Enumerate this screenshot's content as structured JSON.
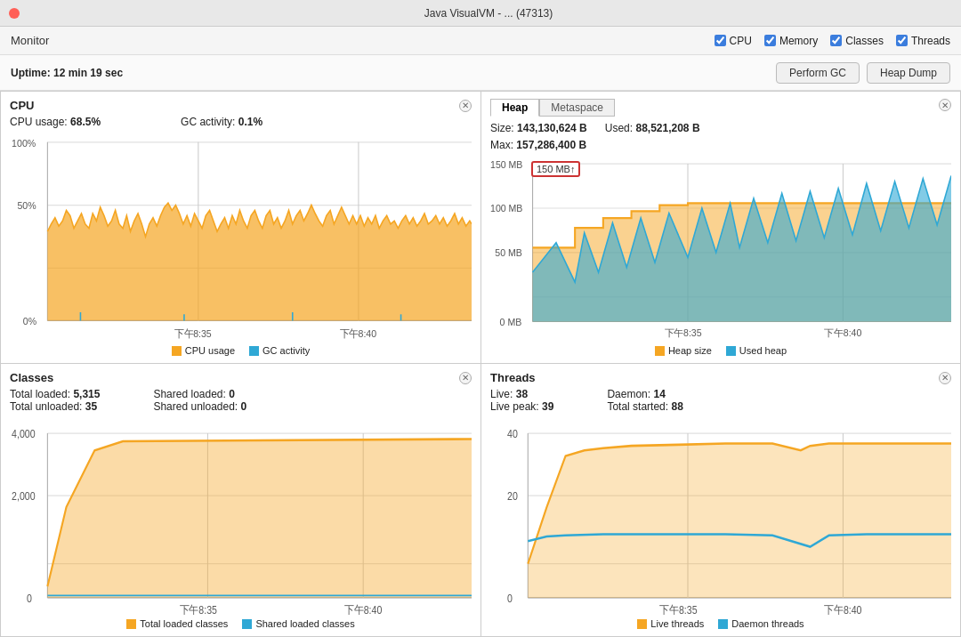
{
  "titlebar": {
    "title": "Java VisualVM - ... (47313)"
  },
  "toolbar": {
    "label": "Monitor",
    "checkboxes": [
      {
        "id": "cpu",
        "label": "CPU",
        "checked": true
      },
      {
        "id": "memory",
        "label": "Memory",
        "checked": true
      },
      {
        "id": "classes",
        "label": "Classes",
        "checked": true
      },
      {
        "id": "threads",
        "label": "Threads",
        "checked": true
      }
    ]
  },
  "statusbar": {
    "uptime_label": "Uptime:",
    "uptime_value": "12 min 19 sec",
    "btn_gc": "Perform GC",
    "btn_heap": "Heap Dump"
  },
  "cpu_panel": {
    "title": "CPU",
    "cpu_usage_label": "CPU usage:",
    "cpu_usage_value": "68.5%",
    "gc_activity_label": "GC activity:",
    "gc_activity_value": "0.1%",
    "legend_cpu": "CPU usage",
    "legend_gc": "GC activity",
    "y_labels": [
      "100%",
      "50%",
      "0%"
    ],
    "x_labels": [
      "下午8:35",
      "下午8:40"
    ]
  },
  "heap_panel": {
    "tabs": [
      "Heap",
      "Metaspace"
    ],
    "active_tab": "Heap",
    "size_label": "Size:",
    "size_value": "143,130,624 B",
    "used_label": "Used:",
    "used_value": "88,521,208 B",
    "max_label": "Max:",
    "max_value": "157,286,400 B",
    "tooltip_value": "150 MB↑",
    "legend_heap_size": "Heap size",
    "legend_used_heap": "Used heap",
    "y_labels": [
      "150 MB",
      "100 MB",
      "50 MB",
      "0 MB"
    ],
    "x_labels": [
      "下午8:35",
      "下午8:40"
    ]
  },
  "classes_panel": {
    "title": "Classes",
    "total_loaded_label": "Total loaded:",
    "total_loaded_value": "5,315",
    "total_unloaded_label": "Total unloaded:",
    "total_unloaded_value": "35",
    "shared_loaded_label": "Shared loaded:",
    "shared_loaded_value": "0",
    "shared_unloaded_label": "Shared unloaded:",
    "shared_unloaded_value": "0",
    "legend_total": "Total loaded classes",
    "legend_shared": "Shared loaded classes",
    "y_labels": [
      "4,000",
      "2,000",
      "0"
    ],
    "x_labels": [
      "下午8:35",
      "下午8:40"
    ]
  },
  "threads_panel": {
    "title": "Threads",
    "live_label": "Live:",
    "live_value": "38",
    "live_peak_label": "Live peak:",
    "live_peak_value": "39",
    "daemon_label": "Daemon:",
    "daemon_value": "14",
    "total_started_label": "Total started:",
    "total_started_value": "88",
    "legend_live": "Live threads",
    "legend_daemon": "Daemon threads",
    "y_labels": [
      "40",
      "20",
      "0"
    ],
    "x_labels": [
      "下午8:35",
      "下午8:40"
    ]
  },
  "colors": {
    "orange": "#f5a623",
    "blue": "#2fa8d5",
    "panel_border": "#cccccc",
    "checkbox_blue": "#3b7ddd"
  }
}
